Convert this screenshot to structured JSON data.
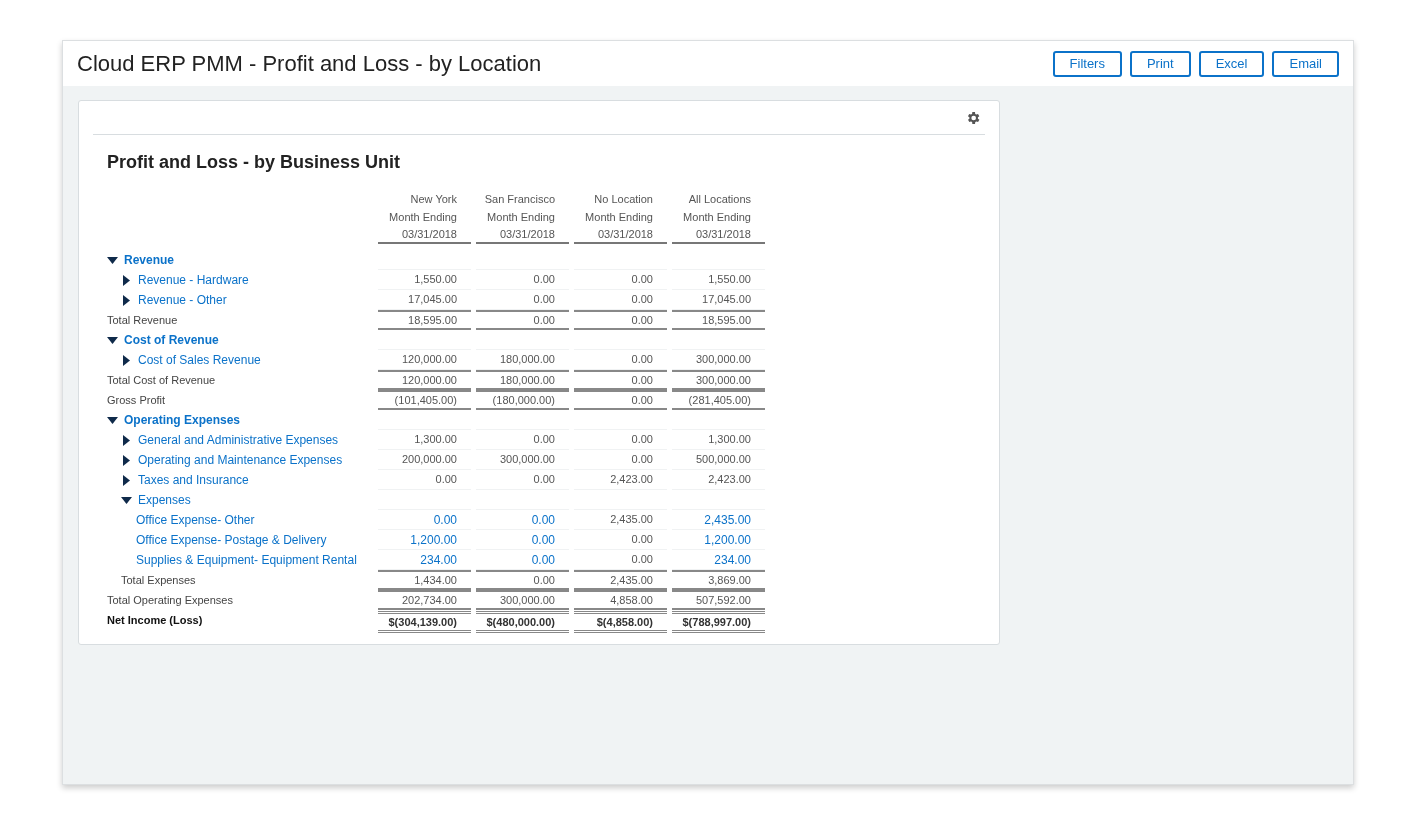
{
  "header": {
    "title": "Cloud ERP PMM - Profit and Loss - by Location",
    "buttons": [
      "Filters",
      "Print",
      "Excel",
      "Email"
    ]
  },
  "report": {
    "title": "Profit and Loss - by Business Unit",
    "columns": [
      {
        "location": "New York",
        "period": "Month Ending",
        "date": "03/31/2018"
      },
      {
        "location": "San Francisco",
        "period": "Month Ending",
        "date": "03/31/2018"
      },
      {
        "location": "No Location",
        "period": "Month Ending",
        "date": "03/31/2018"
      },
      {
        "location": "All Locations",
        "period": "Month Ending",
        "date": "03/31/2018"
      }
    ],
    "rows": [
      {
        "kind": "section",
        "label": "Revenue",
        "expanded": true,
        "children": [
          {
            "kind": "group",
            "label": "Revenue - Hardware",
            "expanded": false,
            "values": [
              "1,550.00",
              "0.00",
              "0.00",
              "1,550.00"
            ]
          },
          {
            "kind": "group",
            "label": "Revenue - Other",
            "expanded": false,
            "values": [
              "17,045.00",
              "0.00",
              "0.00",
              "17,045.00"
            ]
          }
        ]
      },
      {
        "kind": "total",
        "label": "Total Revenue",
        "values": [
          "18,595.00",
          "0.00",
          "0.00",
          "18,595.00"
        ]
      },
      {
        "kind": "section",
        "label": "Cost of Revenue",
        "expanded": true,
        "children": [
          {
            "kind": "group",
            "label": "Cost of Sales Revenue",
            "expanded": false,
            "values": [
              "120,000.00",
              "180,000.00",
              "0.00",
              "300,000.00"
            ]
          }
        ]
      },
      {
        "kind": "total",
        "label": "Total Cost of Revenue",
        "values": [
          "120,000.00",
          "180,000.00",
          "0.00",
          "300,000.00"
        ]
      },
      {
        "kind": "total",
        "label": "Gross Profit",
        "values": [
          "(101,405.00)",
          "(180,000.00)",
          "0.00",
          "(281,405.00)"
        ]
      },
      {
        "kind": "section",
        "label": "Operating Expenses",
        "expanded": true,
        "children": [
          {
            "kind": "group",
            "label": "General and Administrative Expenses",
            "expanded": false,
            "values": [
              "1,300.00",
              "0.00",
              "0.00",
              "1,300.00"
            ]
          },
          {
            "kind": "group",
            "label": "Operating and Maintenance Expenses",
            "expanded": false,
            "values": [
              "200,000.00",
              "300,000.00",
              "0.00",
              "500,000.00"
            ]
          },
          {
            "kind": "group",
            "label": "Taxes and Insurance",
            "expanded": false,
            "values": [
              "0.00",
              "0.00",
              "2,423.00",
              "2,423.00"
            ]
          },
          {
            "kind": "group",
            "label": "Expenses",
            "expanded": true,
            "children": [
              {
                "kind": "account",
                "label": "Office Expense- Other",
                "values": [
                  "0.00",
                  "0.00",
                  "2,435.00",
                  "2,435.00"
                ],
                "links": [
                  true,
                  true,
                  false,
                  true
                ]
              },
              {
                "kind": "account",
                "label": "Office Expense- Postage & Delivery",
                "values": [
                  "1,200.00",
                  "0.00",
                  "0.00",
                  "1,200.00"
                ],
                "links": [
                  true,
                  true,
                  false,
                  true
                ]
              },
              {
                "kind": "account",
                "label": "Supplies & Equipment- Equipment Rental",
                "values": [
                  "234.00",
                  "0.00",
                  "0.00",
                  "234.00"
                ],
                "links": [
                  true,
                  true,
                  false,
                  true
                ]
              }
            ]
          },
          {
            "kind": "total",
            "label": "Total Expenses",
            "values": [
              "1,434.00",
              "0.00",
              "2,435.00",
              "3,869.00"
            ]
          }
        ]
      },
      {
        "kind": "total",
        "label": "Total Operating Expenses",
        "values": [
          "202,734.00",
          "300,000.00",
          "4,858.00",
          "507,592.00"
        ]
      },
      {
        "kind": "net",
        "label": "Net Income (Loss)",
        "values": [
          "$(304,139.00)",
          "$(480,000.00)",
          "$(4,858.00)",
          "$(788,997.00)"
        ]
      }
    ]
  }
}
